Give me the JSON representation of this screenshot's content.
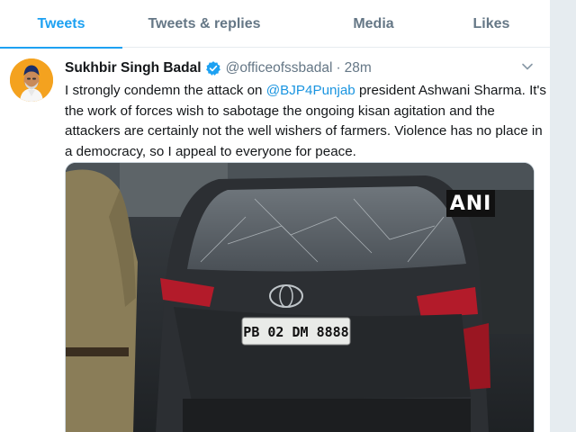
{
  "tabs": [
    {
      "label": "Tweets",
      "active": true
    },
    {
      "label": "Tweets & replies",
      "active": false
    },
    {
      "label": "Media",
      "active": false
    },
    {
      "label": "Likes",
      "active": false
    }
  ],
  "tweet": {
    "author_name": "Sukhbir Singh Badal",
    "handle": "@officeofssbadal",
    "separator": "·",
    "time": "28m",
    "text_before": "I strongly condemn the attack on ",
    "mention": "@BJP4Punjab",
    "text_after": " president Ashwani Sharma. It's the work of forces wish to sabotage the ongoing kisan agitation and the attackers are certainly not the well wishers of farmers. Violence has no place in a democracy, so I appeal to everyone for peace.",
    "media": {
      "watermark": "ANI",
      "license_plate": "PB 02 DM 8888"
    }
  },
  "colors": {
    "accent": "#1da1f2",
    "mention": "#1b95e0",
    "muted": "#657786"
  },
  "icons": {
    "verified": "verified-badge-icon",
    "caret": "chevron-down-icon"
  }
}
